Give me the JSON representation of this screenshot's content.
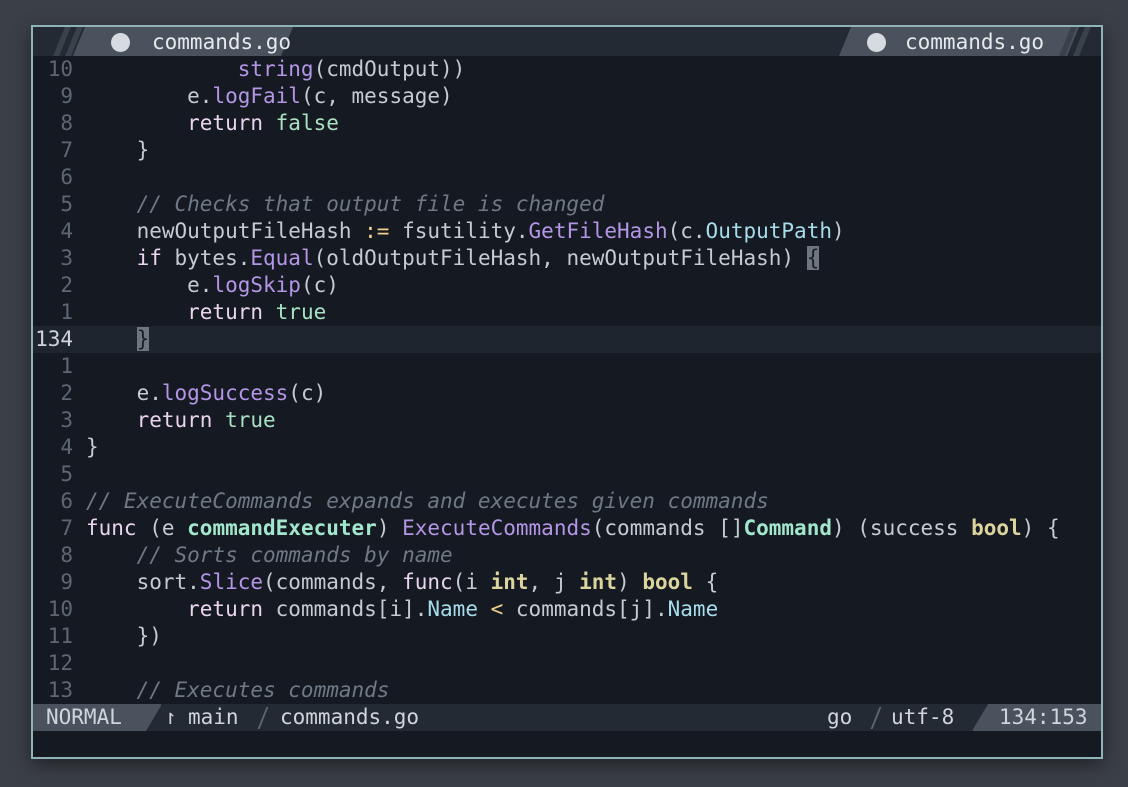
{
  "tabline": {
    "left_tab": {
      "name": "commands.go"
    },
    "right_tab": {
      "name": "commands.go"
    }
  },
  "lines": [
    {
      "num": "10",
      "current": false,
      "segments": [
        [
          "s",
          "            "
        ],
        [
          "f",
          "string"
        ],
        [
          "s",
          "(cmdOutput))"
        ]
      ]
    },
    {
      "num": "9",
      "current": false,
      "segments": [
        [
          "s",
          "        e."
        ],
        [
          "f",
          "logFail"
        ],
        [
          "s",
          "(c, message)"
        ]
      ]
    },
    {
      "num": "8",
      "current": false,
      "segments": [
        [
          "k",
          "        return "
        ],
        [
          "tr",
          "false"
        ]
      ]
    },
    {
      "num": "7",
      "current": false,
      "segments": [
        [
          "s",
          "    }"
        ]
      ]
    },
    {
      "num": "6",
      "current": false,
      "segments": [
        [
          "s",
          ""
        ]
      ]
    },
    {
      "num": "5",
      "current": false,
      "segments": [
        [
          "cm",
          "    // Checks that output file is changed"
        ]
      ]
    },
    {
      "num": "4",
      "current": false,
      "segments": [
        [
          "s",
          "    newOutputFileHash "
        ],
        [
          "o",
          ":="
        ],
        [
          "s",
          " fsutility."
        ],
        [
          "f",
          "GetFileHash"
        ],
        [
          "s",
          "(c."
        ],
        [
          "fld",
          "OutputPath"
        ],
        [
          "s",
          ")"
        ]
      ]
    },
    {
      "num": "3",
      "current": false,
      "segments": [
        [
          "k",
          "    if"
        ],
        [
          "s",
          " bytes."
        ],
        [
          "f",
          "Equal"
        ],
        [
          "s",
          "(oldOutputFileHash, newOutputFileHash) "
        ],
        [
          "hl",
          "{"
        ]
      ]
    },
    {
      "num": "2",
      "current": false,
      "segments": [
        [
          "s",
          "        e."
        ],
        [
          "f",
          "logSkip"
        ],
        [
          "s",
          "(c)"
        ]
      ]
    },
    {
      "num": "1",
      "current": false,
      "segments": [
        [
          "k",
          "        return "
        ],
        [
          "tr",
          "true"
        ]
      ]
    },
    {
      "num": "134",
      "current": true,
      "segments": [
        [
          "s",
          "    "
        ],
        [
          "hl",
          "}"
        ]
      ]
    },
    {
      "num": "1",
      "current": false,
      "segments": [
        [
          "s",
          ""
        ]
      ]
    },
    {
      "num": "2",
      "current": false,
      "segments": [
        [
          "s",
          "    e."
        ],
        [
          "f",
          "logSuccess"
        ],
        [
          "s",
          "(c)"
        ]
      ]
    },
    {
      "num": "3",
      "current": false,
      "segments": [
        [
          "k",
          "    return "
        ],
        [
          "tr",
          "true"
        ]
      ]
    },
    {
      "num": "4",
      "current": false,
      "segments": [
        [
          "s",
          "}"
        ]
      ]
    },
    {
      "num": "5",
      "current": false,
      "segments": [
        [
          "s",
          ""
        ]
      ]
    },
    {
      "num": "6",
      "current": false,
      "segments": [
        [
          "cm",
          "// ExecuteCommands expands and executes given commands"
        ]
      ]
    },
    {
      "num": "7",
      "current": false,
      "segments": [
        [
          "k",
          "func"
        ],
        [
          "s",
          " (e "
        ],
        [
          "t",
          "commandExecuter"
        ],
        [
          "s",
          ") "
        ],
        [
          "f",
          "ExecuteCommands"
        ],
        [
          "s",
          "(commands []"
        ],
        [
          "t",
          "Command"
        ],
        [
          "s",
          ") (success "
        ],
        [
          "b",
          "bool"
        ],
        [
          "s",
          ") {"
        ]
      ]
    },
    {
      "num": "8",
      "current": false,
      "segments": [
        [
          "cm",
          "    // Sorts commands by name"
        ]
      ]
    },
    {
      "num": "9",
      "current": false,
      "segments": [
        [
          "s",
          "    sort."
        ],
        [
          "f",
          "Slice"
        ],
        [
          "s",
          "(commands, "
        ],
        [
          "k",
          "func"
        ],
        [
          "s",
          "(i "
        ],
        [
          "b",
          "int"
        ],
        [
          "s",
          ", j "
        ],
        [
          "b",
          "int"
        ],
        [
          "s",
          ") "
        ],
        [
          "b",
          "bool"
        ],
        [
          "s",
          " {"
        ]
      ]
    },
    {
      "num": "10",
      "current": false,
      "segments": [
        [
          "k",
          "        return"
        ],
        [
          "s",
          " commands[i]."
        ],
        [
          "fld",
          "Name"
        ],
        [
          "o",
          " <"
        ],
        [
          "s",
          " commands[j]."
        ],
        [
          "fld",
          "Name"
        ]
      ]
    },
    {
      "num": "11",
      "current": false,
      "segments": [
        [
          "s",
          "    })"
        ]
      ]
    },
    {
      "num": "12",
      "current": false,
      "segments": [
        [
          "s",
          ""
        ]
      ]
    },
    {
      "num": "13",
      "current": false,
      "segments": [
        [
          "cm",
          "    // Executes commands"
        ]
      ]
    }
  ],
  "statusline": {
    "mode": "NORMAL",
    "branch_icon": "git-branch-icon",
    "branch": "main",
    "file": "commands.go",
    "filetype": "go",
    "encoding": "utf-8",
    "position": "134:153"
  },
  "colors": {
    "background": "#151a22",
    "keyword": "#ead4ee",
    "function": "#b495e6",
    "type": "#a2e7cc",
    "builtin": "#dcd49d",
    "comment": "#6f7985",
    "field": "#a6dcec",
    "border": "#8fb3b8"
  }
}
